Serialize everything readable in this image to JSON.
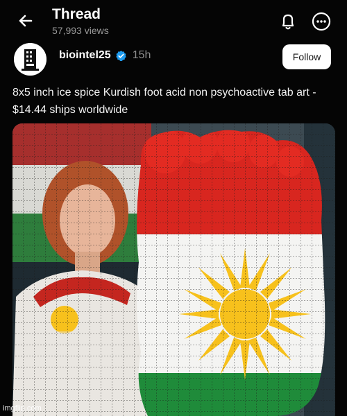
{
  "header": {
    "title": "Thread",
    "views": "57,993 views"
  },
  "post": {
    "username": "biointel25",
    "verified": true,
    "time": "15h",
    "follow_label": "Follow",
    "text": "8x5 inch ice spice Kurdish foot acid non psychoactive tab art - $14.44 ships worldwide"
  },
  "icons": {
    "back": "arrow-left-icon",
    "bell": "bell-icon",
    "more": "more-horizontal-icon",
    "verified": "verified-badge-icon"
  },
  "colors": {
    "background": "#050505",
    "verified_blue": "#1d9bf0",
    "kurdish_red": "#d8261f",
    "kurdish_green": "#1f8b3a",
    "sun_yellow": "#f7c11c"
  },
  "watermark": "imgflip.com"
}
